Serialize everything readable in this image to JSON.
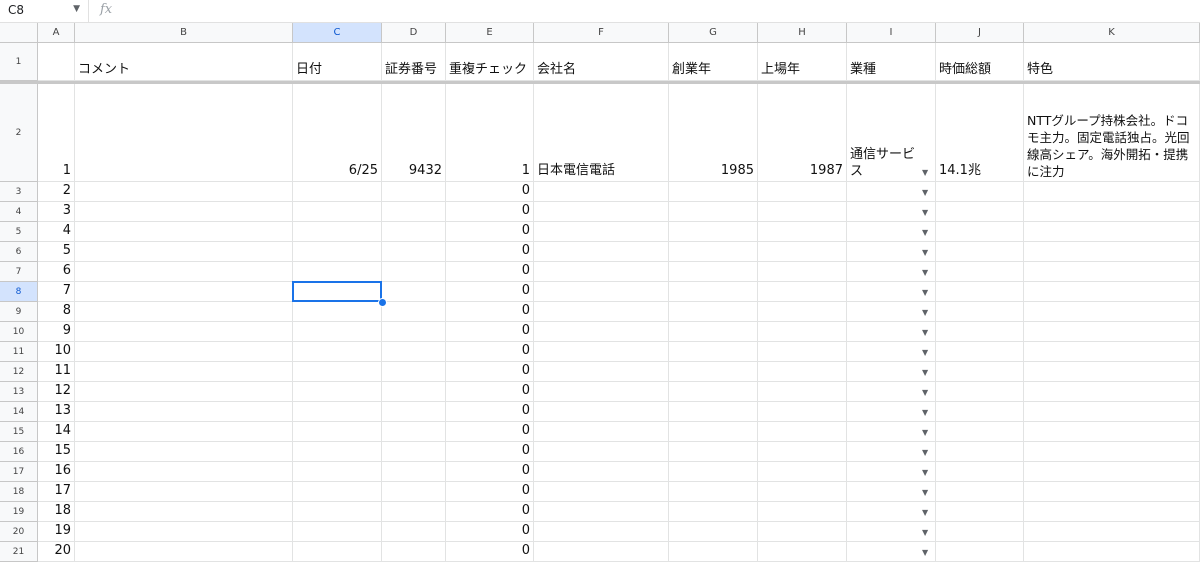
{
  "formula_bar": {
    "name_box": "C8",
    "fx_label": "fx",
    "formula": ""
  },
  "columns": [
    "A",
    "B",
    "C",
    "D",
    "E",
    "F",
    "G",
    "H",
    "I",
    "J",
    "K"
  ],
  "selected_column": "C",
  "selected_row": "8",
  "row_numbers": [
    "1",
    "2",
    "3",
    "4",
    "5",
    "6",
    "7",
    "8",
    "9",
    "10",
    "11",
    "12",
    "13",
    "14",
    "15",
    "16",
    "17",
    "18",
    "19",
    "20",
    "21"
  ],
  "headers": {
    "A": "",
    "B": "コメント",
    "C": "日付",
    "D": "証券番号",
    "E": "重複チェック",
    "F": "会社名",
    "G": "創業年",
    "H": "上場年",
    "I": "業種",
    "J": "時価総額",
    "K": "特色"
  },
  "row2": {
    "A": "1",
    "B": "",
    "C": "6/25",
    "D": "9432",
    "E": "1",
    "F": "日本電信電話",
    "G": "1985",
    "H": "1987",
    "I": "通信サービス",
    "J": "14.1兆",
    "K": "NTTグループ持株会社。ドコモ主力。固定電話独占。光回線高シェア。海外開拓・提携に注力"
  },
  "data_rows": [
    {
      "A": "2",
      "E": "0"
    },
    {
      "A": "3",
      "E": "0"
    },
    {
      "A": "4",
      "E": "0"
    },
    {
      "A": "5",
      "E": "0"
    },
    {
      "A": "6",
      "E": "0"
    },
    {
      "A": "7",
      "E": "0"
    },
    {
      "A": "8",
      "E": "0"
    },
    {
      "A": "9",
      "E": "0"
    },
    {
      "A": "10",
      "E": "0"
    },
    {
      "A": "11",
      "E": "0"
    },
    {
      "A": "12",
      "E": "0"
    },
    {
      "A": "13",
      "E": "0"
    },
    {
      "A": "14",
      "E": "0"
    },
    {
      "A": "15",
      "E": "0"
    },
    {
      "A": "16",
      "E": "0"
    },
    {
      "A": "17",
      "E": "0"
    },
    {
      "A": "18",
      "E": "0"
    },
    {
      "A": "19",
      "E": "0"
    },
    {
      "A": "20",
      "E": "0"
    }
  ],
  "colors": {
    "selection": "#1a73e8",
    "header_selected_bg": "#d3e3fd"
  }
}
